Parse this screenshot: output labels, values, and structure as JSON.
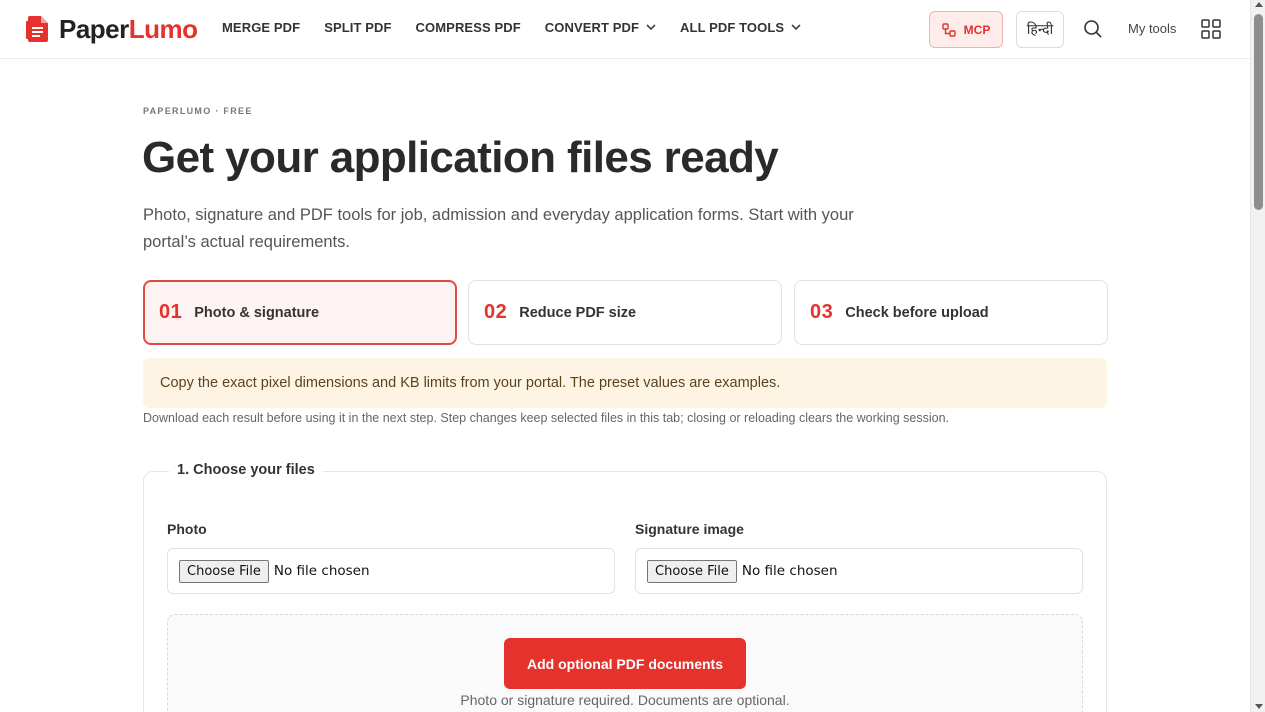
{
  "header": {
    "logo_part1": "Paper",
    "logo_part2": "Lumo",
    "nav": [
      "MERGE PDF",
      "SPLIT PDF",
      "COMPRESS PDF",
      "CONVERT PDF",
      "ALL PDF TOOLS"
    ],
    "mcp_label": "MCP",
    "lang_label": "हिन्दी",
    "my_tools_label": "My tools"
  },
  "hero": {
    "eyebrow": "PAPERLUMO · FREE",
    "title": "Get your application files ready",
    "subtitle": "Photo, signature and PDF tools for job, admission and everyday application forms. Start with your portal’s actual requirements."
  },
  "steps": [
    {
      "num": "01",
      "label": "Photo & signature",
      "active": true
    },
    {
      "num": "02",
      "label": "Reduce PDF size",
      "active": false
    },
    {
      "num": "03",
      "label": "Check before upload",
      "active": false
    }
  ],
  "notice": "Copy the exact pixel dimensions and KB limits from your portal. The preset values are examples.",
  "hint": "Download each result before using it in the next step. Step changes keep selected files in this tab; closing or reloading clears the working session.",
  "form": {
    "legend": "1. Choose your files",
    "photo_label": "Photo",
    "signature_label": "Signature image",
    "choose_file": "Choose File",
    "no_file": "No file chosen",
    "add_pdf_button": "Add optional PDF documents",
    "drop_hint": "Photo or signature required. Documents are optional."
  },
  "colors": {
    "brand": "#e5322d",
    "notice_bg": "#fef4e4"
  }
}
